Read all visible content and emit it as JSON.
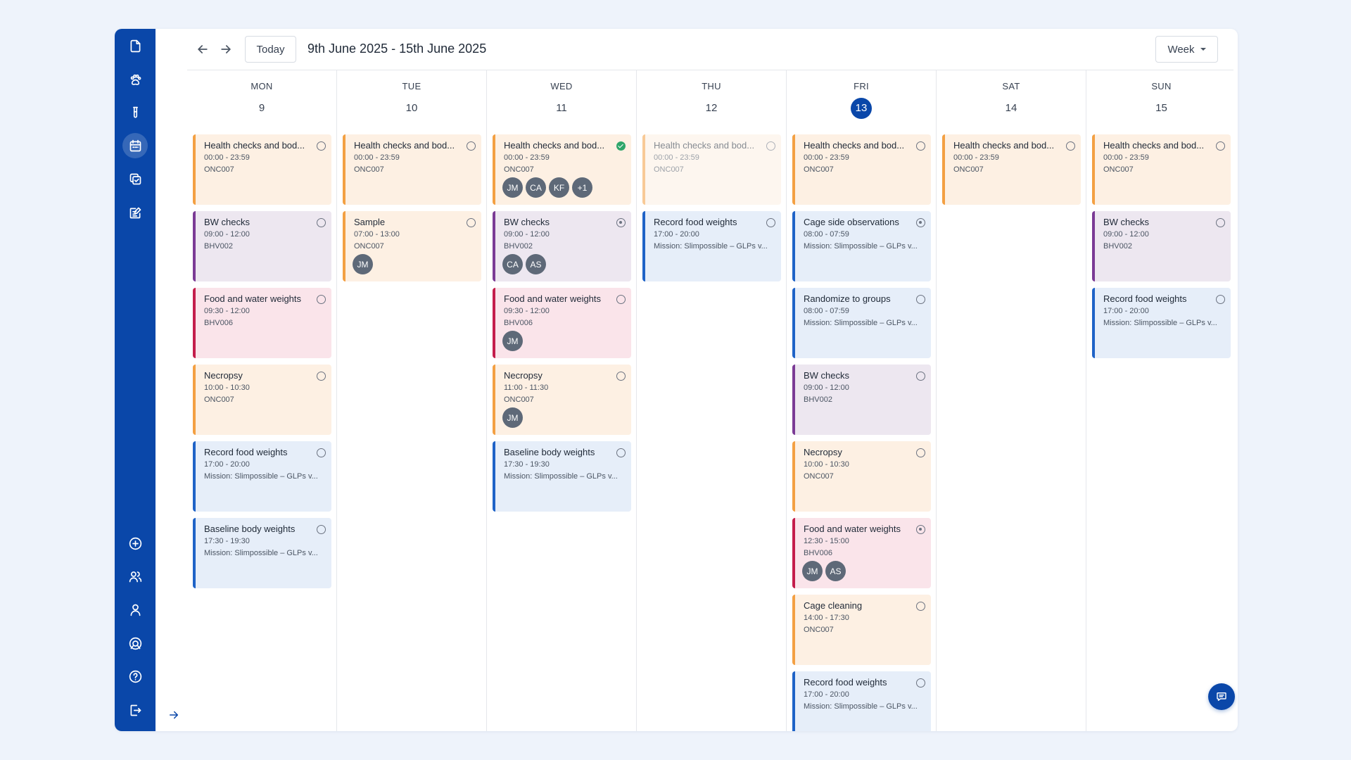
{
  "sidebar": {
    "top_icons": [
      "document-icon",
      "paw-icon",
      "test-tube-icon",
      "calendar-icon",
      "copy-icon",
      "edit-list-icon"
    ],
    "bottom_icons": [
      "plus-circle-icon",
      "users-icon",
      "user-icon",
      "support-icon",
      "help-icon",
      "logout-icon"
    ],
    "active": "calendar-icon"
  },
  "toolbar": {
    "today_label": "Today",
    "date_range": "9th June 2025 - 15th June 2025",
    "view_label": "Week"
  },
  "days": [
    {
      "name": "MON",
      "num": "9",
      "today": false,
      "events": [
        {
          "title": "Health checks and bod...",
          "time": "00:00 - 23:59",
          "code": "ONC007",
          "color": "orange",
          "status": "open",
          "avatars": []
        },
        {
          "title": "BW checks",
          "time": "09:00 - 12:00",
          "code": "BHV002",
          "color": "purple",
          "status": "open",
          "avatars": []
        },
        {
          "title": "Food and water weights",
          "time": "09:30 - 12:00",
          "code": "BHV006",
          "color": "red",
          "status": "open",
          "avatars": []
        },
        {
          "title": "Necropsy",
          "time": "10:00 - 10:30",
          "code": "ONC007",
          "color": "orange",
          "status": "open",
          "avatars": []
        },
        {
          "title": "Record food weights",
          "time": "17:00 - 20:00",
          "code": "Mission: Slimpossible – GLPs v...",
          "color": "blue",
          "status": "open",
          "avatars": []
        },
        {
          "title": "Baseline body weights",
          "time": "17:30 - 19:30",
          "code": "Mission: Slimpossible – GLPs v...",
          "color": "blue",
          "status": "open",
          "avatars": []
        }
      ]
    },
    {
      "name": "TUE",
      "num": "10",
      "today": false,
      "events": [
        {
          "title": "Health checks and bod...",
          "time": "00:00 - 23:59",
          "code": "ONC007",
          "color": "orange",
          "status": "open",
          "avatars": []
        },
        {
          "title": "Sample",
          "time": "07:00 - 13:00",
          "code": "ONC007",
          "color": "orange",
          "status": "open",
          "avatars": [
            "JM"
          ]
        }
      ]
    },
    {
      "name": "WED",
      "num": "11",
      "today": false,
      "events": [
        {
          "title": "Health checks and bod...",
          "time": "00:00 - 23:59",
          "code": "ONC007",
          "color": "orange",
          "status": "done",
          "avatars": [
            "JM",
            "CA",
            "KF",
            "+1"
          ]
        },
        {
          "title": "BW checks",
          "time": "09:00 - 12:00",
          "code": "BHV002",
          "color": "purple",
          "status": "progress",
          "avatars": [
            "CA",
            "AS"
          ]
        },
        {
          "title": "Food and water weights",
          "time": "09:30 - 12:00",
          "code": "BHV006",
          "color": "red",
          "status": "open",
          "avatars": [
            "JM"
          ]
        },
        {
          "title": "Necropsy",
          "time": "11:00 - 11:30",
          "code": "ONC007",
          "color": "orange",
          "status": "open",
          "avatars": [
            "JM"
          ]
        },
        {
          "title": "Baseline body weights",
          "time": "17:30 - 19:30",
          "code": "Mission: Slimpossible – GLPs v...",
          "color": "blue",
          "status": "open",
          "avatars": []
        }
      ]
    },
    {
      "name": "THU",
      "num": "12",
      "today": false,
      "events": [
        {
          "title": "Health checks and bod...",
          "time": "00:00 - 23:59",
          "code": "ONC007",
          "color": "orange",
          "status": "open",
          "faded": true,
          "avatars": []
        },
        {
          "title": "Record food weights",
          "time": "17:00 - 20:00",
          "code": "Mission: Slimpossible – GLPs v...",
          "color": "blue",
          "status": "open",
          "avatars": []
        }
      ]
    },
    {
      "name": "FRI",
      "num": "13",
      "today": true,
      "events": [
        {
          "title": "Health checks and bod...",
          "time": "00:00 - 23:59",
          "code": "ONC007",
          "color": "orange",
          "status": "open",
          "avatars": []
        },
        {
          "title": "Cage side observations",
          "time": "08:00 - 07:59",
          "code": "Mission: Slimpossible – GLPs v...",
          "color": "blue",
          "status": "progress",
          "avatars": []
        },
        {
          "title": "Randomize to groups",
          "time": "08:00 - 07:59",
          "code": "Mission: Slimpossible – GLPs v...",
          "color": "blue",
          "status": "open",
          "avatars": []
        },
        {
          "title": "BW checks",
          "time": "09:00 - 12:00",
          "code": "BHV002",
          "color": "purple",
          "status": "open",
          "avatars": []
        },
        {
          "title": "Necropsy",
          "time": "10:00 - 10:30",
          "code": "ONC007",
          "color": "orange",
          "status": "open",
          "avatars": []
        },
        {
          "title": "Food and water weights",
          "time": "12:30 - 15:00",
          "code": "BHV006",
          "color": "red",
          "status": "progress",
          "avatars": [
            "JM",
            "AS"
          ]
        },
        {
          "title": "Cage cleaning",
          "time": "14:00 - 17:30",
          "code": "ONC007",
          "color": "orange",
          "status": "open",
          "avatars": []
        },
        {
          "title": "Record food weights",
          "time": "17:00 - 20:00",
          "code": "Mission: Slimpossible – GLPs v...",
          "color": "blue",
          "status": "open",
          "avatars": []
        }
      ]
    },
    {
      "name": "SAT",
      "num": "14",
      "today": false,
      "events": [
        {
          "title": "Health checks and bod...",
          "time": "00:00 - 23:59",
          "code": "ONC007",
          "color": "orange",
          "status": "open",
          "avatars": []
        }
      ]
    },
    {
      "name": "SUN",
      "num": "15",
      "today": false,
      "events": [
        {
          "title": "Health checks and bod...",
          "time": "00:00 - 23:59",
          "code": "ONC007",
          "color": "orange",
          "status": "open",
          "avatars": []
        },
        {
          "title": "BW checks",
          "time": "09:00 - 12:00",
          "code": "BHV002",
          "color": "purple",
          "status": "open",
          "avatars": []
        },
        {
          "title": "Record food weights",
          "time": "17:00 - 20:00",
          "code": "Mission: Slimpossible – GLPs v...",
          "color": "blue",
          "status": "open",
          "avatars": []
        }
      ]
    }
  ],
  "colors": {
    "brand": "#0a47a9",
    "orange": "#f3a043",
    "purple": "#7b3b95",
    "red": "#c41e4c",
    "blue": "#1f63c7",
    "done": "#2ea66b"
  }
}
